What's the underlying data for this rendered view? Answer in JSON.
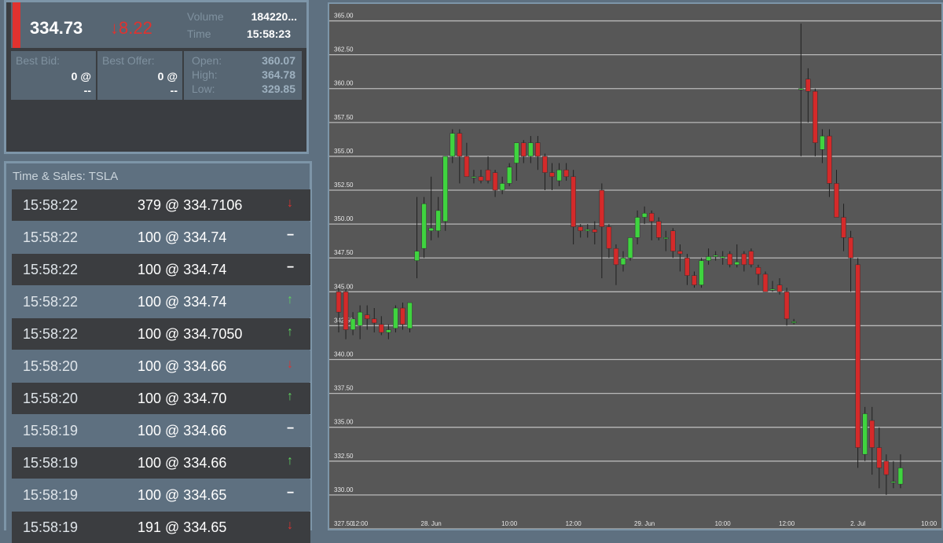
{
  "quote": {
    "last": "334.73",
    "change": "↓8.22",
    "volume_label": "Volume",
    "volume_value": "184220...",
    "time_label": "Time",
    "time_value": "15:58:23",
    "best_bid_label": "Best Bid:",
    "best_bid_value": "0 @",
    "best_bid_size": "--",
    "best_offer_label": "Best Offer:",
    "best_offer_value": "0 @",
    "best_offer_size": "--",
    "open_label": "Open:",
    "open_value": "360.07",
    "high_label": "High:",
    "high_value": "364.78",
    "low_label": "Low:",
    "low_value": "329.85"
  },
  "time_sales": {
    "title": "Time & Sales: TSLA",
    "rows": [
      {
        "time": "15:58:22",
        "trade": "379 @ 334.7106",
        "dir": "down"
      },
      {
        "time": "15:58:22",
        "trade": "100 @ 334.74",
        "dir": "flat"
      },
      {
        "time": "15:58:22",
        "trade": "100 @ 334.74",
        "dir": "flat"
      },
      {
        "time": "15:58:22",
        "trade": "100 @ 334.74",
        "dir": "up"
      },
      {
        "time": "15:58:22",
        "trade": "100 @ 334.7050",
        "dir": "up"
      },
      {
        "time": "15:58:20",
        "trade": "100 @ 334.66",
        "dir": "down"
      },
      {
        "time": "15:58:20",
        "trade": "100 @ 334.70",
        "dir": "up"
      },
      {
        "time": "15:58:19",
        "trade": "100 @ 334.66",
        "dir": "flat"
      },
      {
        "time": "15:58:19",
        "trade": "100 @ 334.66",
        "dir": "up"
      },
      {
        "time": "15:58:19",
        "trade": "100 @ 334.65",
        "dir": "flat"
      },
      {
        "time": "15:58:19",
        "trade": "191 @ 334.65",
        "dir": "down"
      }
    ],
    "arrows": {
      "up": "↑",
      "down": "↓",
      "flat": "−"
    },
    "colors": {
      "up": "#5fd35f",
      "down": "#e0322f",
      "flat": "#ffffff"
    }
  },
  "chart_data": {
    "type": "candlestick",
    "ylim": [
      327.5,
      366.25
    ],
    "y_ticks": [
      "327.50",
      "330.00",
      "332.50",
      "335.00",
      "337.50",
      "340.00",
      "342.50",
      "345.00",
      "347.50",
      "350.00",
      "352.50",
      "355.00",
      "357.50",
      "360.00",
      "362.50",
      "365.00"
    ],
    "x_ticks": [
      "12:00",
      "28. Jun",
      "10:00",
      "12:00",
      "29. Jun",
      "10:00",
      "12:00",
      "2. Jul",
      "10:00"
    ],
    "x_tick_index": [
      3,
      13,
      24,
      33,
      43,
      54,
      63,
      73,
      83
    ],
    "colors": {
      "up": "#3fd43f",
      "down": "#d42a2a",
      "wick": "#202020",
      "grid": "#b9b9b9",
      "tick": "#e8e8e8"
    },
    "candles": [
      [
        345.0,
        345.3,
        342.0,
        343.5
      ],
      [
        345.0,
        345.2,
        341.5,
        342.2
      ],
      [
        342.2,
        343.5,
        341.8,
        343.0
      ],
      [
        342.5,
        344.0,
        341.5,
        343.5
      ],
      [
        343.3,
        344.0,
        342.2,
        343.0
      ],
      [
        343.0,
        343.8,
        342.0,
        342.7
      ],
      [
        342.6,
        343.2,
        341.8,
        342.0
      ],
      [
        342.0,
        342.6,
        341.5,
        342.2
      ],
      [
        342.3,
        344.0,
        342.0,
        343.8
      ],
      [
        343.8,
        344.2,
        342.2,
        342.6
      ],
      [
        342.3,
        344.2,
        342.0,
        344.2
      ],
      [
        347.3,
        352.0,
        346.0,
        348.0
      ],
      [
        348.2,
        352.0,
        347.5,
        351.5
      ],
      [
        349.5,
        353.5,
        348.8,
        349.7
      ],
      [
        349.5,
        352.0,
        349.0,
        351.0
      ],
      [
        350.2,
        355.0,
        349.5,
        355.0
      ],
      [
        355.0,
        357.0,
        354.5,
        356.7
      ],
      [
        356.7,
        357.0,
        353.0,
        355.0
      ],
      [
        355.0,
        356.0,
        353.5,
        353.5
      ],
      [
        353.5,
        354.0,
        353.0,
        353.5
      ],
      [
        353.5,
        354.0,
        353.0,
        353.2
      ],
      [
        354.0,
        355.0,
        353.0,
        353.2
      ],
      [
        353.8,
        354.0,
        352.0,
        352.5
      ],
      [
        352.5,
        353.5,
        352.2,
        353.0
      ],
      [
        353.0,
        354.5,
        352.8,
        354.2
      ],
      [
        354.5,
        356.0,
        353.2,
        356.0
      ],
      [
        356.0,
        356.2,
        354.5,
        355.0
      ],
      [
        355.0,
        356.5,
        354.5,
        356.0
      ],
      [
        356.0,
        356.5,
        354.0,
        355.0
      ],
      [
        355.0,
        355.2,
        352.5,
        353.8
      ],
      [
        353.8,
        354.5,
        352.5,
        353.5
      ],
      [
        353.2,
        354.5,
        352.8,
        354.0
      ],
      [
        354.0,
        354.5,
        353.2,
        353.5
      ],
      [
        353.5,
        354.0,
        348.5,
        349.8
      ],
      [
        349.8,
        350.0,
        349.0,
        349.5
      ],
      [
        349.5,
        350.0,
        349.0,
        349.6
      ],
      [
        349.6,
        350.2,
        348.5,
        349.4
      ],
      [
        352.5,
        353.0,
        346.0,
        349.8
      ],
      [
        349.8,
        350.0,
        347.5,
        348.2
      ],
      [
        348.2,
        348.5,
        345.5,
        347.0
      ],
      [
        347.0,
        348.0,
        346.5,
        347.5
      ],
      [
        347.5,
        349.0,
        347.3,
        349.0
      ],
      [
        349.0,
        351.0,
        348.5,
        350.5
      ],
      [
        350.5,
        351.3,
        350.0,
        350.8
      ],
      [
        350.8,
        351.0,
        348.8,
        350.2
      ],
      [
        350.2,
        350.5,
        348.8,
        349.0
      ],
      [
        349.0,
        349.5,
        348.0,
        349.0
      ],
      [
        349.5,
        349.7,
        347.5,
        348.0
      ],
      [
        348.0,
        348.5,
        346.5,
        347.8
      ],
      [
        347.5,
        347.8,
        345.5,
        346.2
      ],
      [
        346.2,
        346.5,
        345.3,
        345.5
      ],
      [
        345.5,
        347.5,
        345.3,
        347.3
      ],
      [
        347.3,
        348.2,
        347.0,
        347.6
      ],
      [
        347.6,
        348.0,
        347.3,
        347.7
      ],
      [
        347.5,
        348.0,
        347.0,
        347.6
      ],
      [
        347.8,
        348.0,
        346.8,
        347.0
      ],
      [
        347.0,
        348.5,
        346.8,
        347.2
      ],
      [
        347.8,
        348.0,
        346.5,
        347.0
      ],
      [
        348.0,
        348.2,
        346.8,
        347.0
      ],
      [
        346.8,
        347.0,
        345.5,
        346.3
      ],
      [
        346.3,
        346.5,
        345.0,
        345.0
      ],
      [
        345.2,
        345.8,
        345.0,
        345.2
      ],
      [
        345.5,
        346.0,
        344.8,
        345.0
      ],
      [
        345.0,
        345.3,
        342.5,
        343.0
      ],
      [
        342.8,
        343.0,
        342.6,
        342.8
      ],
      [
        360.0,
        364.8,
        355.0,
        360.0
      ],
      [
        360.7,
        361.5,
        357.5,
        359.8
      ],
      [
        359.8,
        360.0,
        355.0,
        356.0
      ],
      [
        355.5,
        357.0,
        354.5,
        356.5
      ],
      [
        356.5,
        357.0,
        352.0,
        353.0
      ],
      [
        353.0,
        354.0,
        350.5,
        350.5
      ],
      [
        350.5,
        351.5,
        348.0,
        349.0
      ],
      [
        349.0,
        349.5,
        345.0,
        347.5
      ],
      [
        347.0,
        347.5,
        332.0,
        333.5
      ],
      [
        333.0,
        336.5,
        332.5,
        336.0
      ],
      [
        335.5,
        336.5,
        331.5,
        333.5
      ],
      [
        333.5,
        335.0,
        330.5,
        332.0
      ],
      [
        332.5,
        333.0,
        330.0,
        331.5
      ],
      [
        331.0,
        332.5,
        330.5,
        331.0
      ],
      [
        330.8,
        333.0,
        330.5,
        332.0
      ]
    ]
  }
}
